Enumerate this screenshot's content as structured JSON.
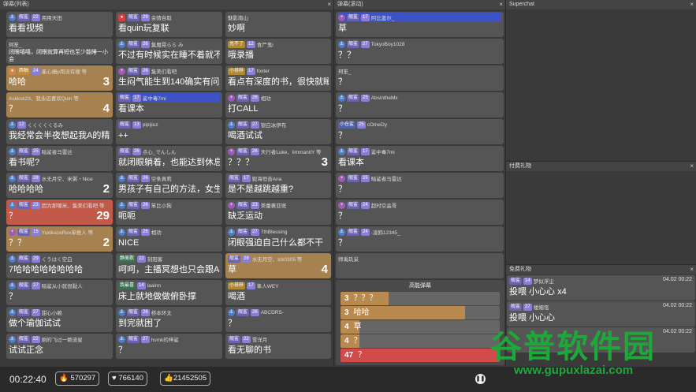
{
  "panels": {
    "list": {
      "title": "弹幕(列表)"
    },
    "scroll": {
      "title": "弹幕(滚动)"
    },
    "superchat": {
      "title": "Superchat"
    },
    "paid_gift": {
      "title": "付费礼物"
    },
    "free_gift": {
      "title": "免费礼物"
    }
  },
  "close_glyph": "×",
  "col1": [
    {
      "icon": "anchor",
      "badge": "舰鲨",
      "lv": "22",
      "name": "用用天田",
      "msg": "看看视频",
      "style": "normal"
    },
    {
      "icon": "",
      "badge": "",
      "lv": "",
      "name": "珂笙_",
      "msg": "闭眼嘻嘻，闭眼就算再短也至少能睡一小会",
      "style": "small"
    },
    {
      "icon": "sq",
      "badge": "西柚",
      "lv": "24",
      "name": "墨心栅p用没有搜 等",
      "msg": "哈哈",
      "style": "gold",
      "count": "3"
    },
    {
      "icon": "",
      "badge": "",
      "lv": "",
      "name": "Askksk23、我永远喜欢Quin 等",
      "msg": "？",
      "style": "gold",
      "count": "4"
    },
    {
      "icon": "anchor",
      "badge": "",
      "lv": "12",
      "name": "くくくくくるみ",
      "msg": "我经常会半夜想起我A的精彩操作睡不着",
      "style": "normal"
    },
    {
      "icon": "anchor",
      "badge": "舰鲨",
      "lv": "25",
      "name": "暗鲨者马雷达",
      "msg": "看书呢?",
      "style": "normal"
    },
    {
      "icon": "anchor",
      "badge": "舰鲨",
      "lv": "28",
      "name": "水无月空、米粥・Nice",
      "msg": "哈哈哈哈",
      "style": "normal",
      "count": "2"
    },
    {
      "icon": "anchor",
      "badge": "舰鲨",
      "lv": "23",
      "name": "因为那哪米、集美们看吧 等",
      "msg": "？",
      "style": "red",
      "count": "29"
    },
    {
      "icon": "plus",
      "badge": "舰鲨",
      "lv": "16",
      "name": "YukikazeRex单推人 等",
      "msg": "？？",
      "style": "gold",
      "count": "2"
    },
    {
      "icon": "anchor",
      "badge": "舰鲨",
      "lv": "29",
      "name": "くうはく空白",
      "msg": "7哈哈哈哈哈哈哈哈",
      "style": "normal"
    },
    {
      "icon": "anchor",
      "badge": "舰鲨",
      "lv": "27",
      "name": "暗鲨从小就很黏人",
      "msg": "？",
      "style": "normal"
    },
    {
      "icon": "anchor",
      "badge": "舰鲨",
      "lv": "27",
      "name": "甜心小赖",
      "msg": "做个瑜伽试试",
      "style": "normal"
    },
    {
      "icon": "anchor",
      "badge": "舰鲨",
      "lv": "22",
      "name": "刷的飞过一颗流星",
      "msg": "试试正念",
      "style": "normal"
    }
  ],
  "col2": [
    {
      "icon": "red",
      "badge": "舰鲨",
      "lv": "29",
      "name": "余情自取",
      "msg": "看quin玩复联",
      "style": "normal"
    },
    {
      "icon": "anchor",
      "badge": "舰鲨",
      "lv": "26",
      "name": "集魔晃らら み",
      "msg": "不过有时候实在睡不着就不睡了",
      "style": "normal"
    },
    {
      "icon": "plus",
      "badge": "舰鲨",
      "lv": "26",
      "name": "集美们看吧",
      "msg": "生闷气能生到140确实有问题",
      "style": "normal"
    },
    {
      "icon": "",
      "badge": "舰鲨",
      "lv": "17",
      "name": "鲨中毒7mi",
      "msg": "看课本",
      "style": "blue"
    },
    {
      "icon": "",
      "badge": "舰鲨",
      "lv": "13",
      "name": "pipijiuz",
      "msg": "++",
      "style": "normal"
    },
    {
      "icon": "",
      "badge": "舰鲨",
      "lv": "26",
      "name": "点心_でんしん",
      "msg": "就闭眼躺着，也能达到休息的效果其实",
      "style": "normal"
    },
    {
      "icon": "anchor",
      "badge": "舰鲨",
      "lv": "26",
      "name": "空条真莉",
      "msg": "男孩子有自己的方法，女生就不知道了",
      "style": "normal"
    },
    {
      "icon": "anchor",
      "badge": "舰鲨",
      "lv": "26",
      "name": "笨比小狗",
      "msg": "呃呃",
      "style": "normal"
    },
    {
      "icon": "anchor",
      "badge": "舰鲨",
      "lv": "26",
      "name": "相劝",
      "msg": "NICE",
      "style": "normal"
    },
    {
      "icon": "",
      "badge": "静美歌",
      "lv": "22",
      "name": "刻阳客",
      "msg": "呵呵，主播冥想也只会跟A相关",
      "style": "normal"
    },
    {
      "icon": "",
      "badge": "我最喜",
      "lv": "14",
      "name": "laainn",
      "msg": "床上就地做做俯卧撑",
      "style": "normal"
    },
    {
      "icon": "anchor",
      "badge": "舰鲨",
      "lv": "26",
      "name": "桥本环太",
      "msg": "到完就困了",
      "style": "normal"
    },
    {
      "icon": "anchor",
      "badge": "舰鲨",
      "lv": "27",
      "name": "hsmk的梓鲨",
      "msg": "？",
      "style": "normal"
    }
  ],
  "col3": [
    {
      "icon": "",
      "badge": "",
      "lv": "",
      "name": "魅影南山",
      "msg": "妙啊",
      "style": "normal"
    },
    {
      "icon": "",
      "badge": "兑不了",
      "lv": "12",
      "name": "食尸鬼i",
      "msg": "哦录播",
      "style": "normal"
    },
    {
      "icon": "",
      "badge": "小孩梓",
      "lv": "17",
      "name": "foxter",
      "msg": "看点有深度的书，很快就睡着了",
      "style": "normal"
    },
    {
      "icon": "plus",
      "badge": "舰鲨",
      "lv": "26",
      "name": "相劝",
      "msg": "打CALL",
      "style": "normal"
    },
    {
      "icon": "anchor",
      "badge": "舰鲨",
      "lv": "27",
      "name": "银白冰伊布",
      "msg": "喝酒试试",
      "style": "normal"
    },
    {
      "icon": "plus",
      "badge": "舰鲨",
      "lv": "26",
      "name": "天行者Luke、limmanitY 等",
      "msg": "？？？",
      "style": "normal",
      "count": "3"
    },
    {
      "icon": "",
      "badge": "舰鲨",
      "lv": "17",
      "name": "毅海恒音Ana",
      "msg": "是不是越跳越重?",
      "style": "normal"
    },
    {
      "icon": "plus",
      "badge": "舰鲨",
      "lv": "23",
      "name": "美蕾裹亚斑",
      "msg": "缺乏运动",
      "style": "normal"
    },
    {
      "icon": "anchor",
      "badge": "舰鲨",
      "lv": "27",
      "name": "7thBlessing",
      "msg": "闭眼强迫自己什么都不干",
      "style": "normal"
    },
    {
      "icon": "",
      "badge": "舰鲨",
      "lv": "28",
      "name": "水无月空、tck0305 等",
      "msg": "草",
      "style": "gold",
      "count": "4"
    },
    {
      "icon": "",
      "badge": "小孩梓",
      "lv": "17",
      "name": "隼人WEY",
      "msg": "喝酒",
      "style": "normal"
    },
    {
      "icon": "anchor",
      "badge": "舰鲨",
      "lv": "26",
      "name": "ABCDRS-",
      "msg": "？",
      "style": "normal"
    },
    {
      "icon": "",
      "badge": "舰鲨",
      "lv": "22",
      "name": "雪洋月",
      "msg": "看无聊的书",
      "style": "normal"
    }
  ],
  "col4": [
    {
      "icon": "plus",
      "badge": "舰鲨",
      "lv": "17",
      "name": "阿比盖尔_",
      "msg": "草",
      "style": "blue"
    },
    {
      "icon": "anchor",
      "badge": "舰鲨",
      "lv": "27",
      "name": "TokyoBoy1028",
      "msg": "？？",
      "style": "normal"
    },
    {
      "icon": "",
      "badge": "",
      "lv": "",
      "name": "珂笙_",
      "msg": "？",
      "style": "normal"
    },
    {
      "icon": "anchor",
      "badge": "舰鲨",
      "lv": "25",
      "name": "AbsintheMx",
      "msg": "？",
      "style": "normal"
    },
    {
      "icon": "",
      "badge": "小仓鲨",
      "lv": "25",
      "name": "cOmeDy",
      "msg": "？",
      "style": "normal"
    },
    {
      "icon": "anchor",
      "badge": "舰鲨",
      "lv": "17",
      "name": "鲨中毒7mi",
      "msg": "看课本",
      "style": "normal"
    },
    {
      "icon": "plus",
      "badge": "舰鲨",
      "lv": "25",
      "name": "暗鲨者马雷达",
      "msg": "？",
      "style": "normal"
    },
    {
      "icon": "plus",
      "badge": "舰鲨",
      "lv": "24",
      "name": "超时空晶哥",
      "msg": "？",
      "style": "normal"
    },
    {
      "icon": "anchor",
      "badge": "舰鲨",
      "lv": "24",
      "name": "-凌鸥12345_",
      "msg": "？",
      "style": "normal"
    },
    {
      "icon": "",
      "badge": "",
      "lv": "",
      "name": "师禹玖采",
      "msg": "",
      "style": "normal"
    }
  ],
  "highenergy": {
    "title": "高能弹幕",
    "rows": [
      {
        "count": "3",
        "text": "？？？",
        "pct": 0.3
      },
      {
        "count": "3",
        "text": "哈哈",
        "pct": 0.78
      },
      {
        "count": "4",
        "text": "草",
        "pct": 0.12
      },
      {
        "count": "4",
        "text": "？",
        "pct": 0.12
      },
      {
        "count": "47",
        "text": "？",
        "pct": 1.0
      }
    ]
  },
  "free_gifts": [
    {
      "badge": "舰鲨",
      "lv": "14",
      "name": "梦似浮尘",
      "time": "04.02 00:22",
      "msg": "投喂 小心心 x4"
    },
    {
      "badge": "舰鲨",
      "lv": "27",
      "name": "楼姻瓴",
      "time": "04.02 00:22",
      "msg": "投喂 小心心"
    },
    {
      "badge": "",
      "lv": "",
      "name": "",
      "time": "04.02 00:22",
      "msg": ""
    }
  ],
  "bottom": {
    "timer": "00:22:40",
    "stat1_icon": "fire-icon",
    "stat1": "570297",
    "stat2_icon": "heart-icon",
    "stat2": "766140",
    "stat3_icon": "like-icon",
    "stat3": "21452505"
  },
  "watermark": {
    "line1": "谷普软件园",
    "line2": "www.gupuxlazai.com"
  }
}
